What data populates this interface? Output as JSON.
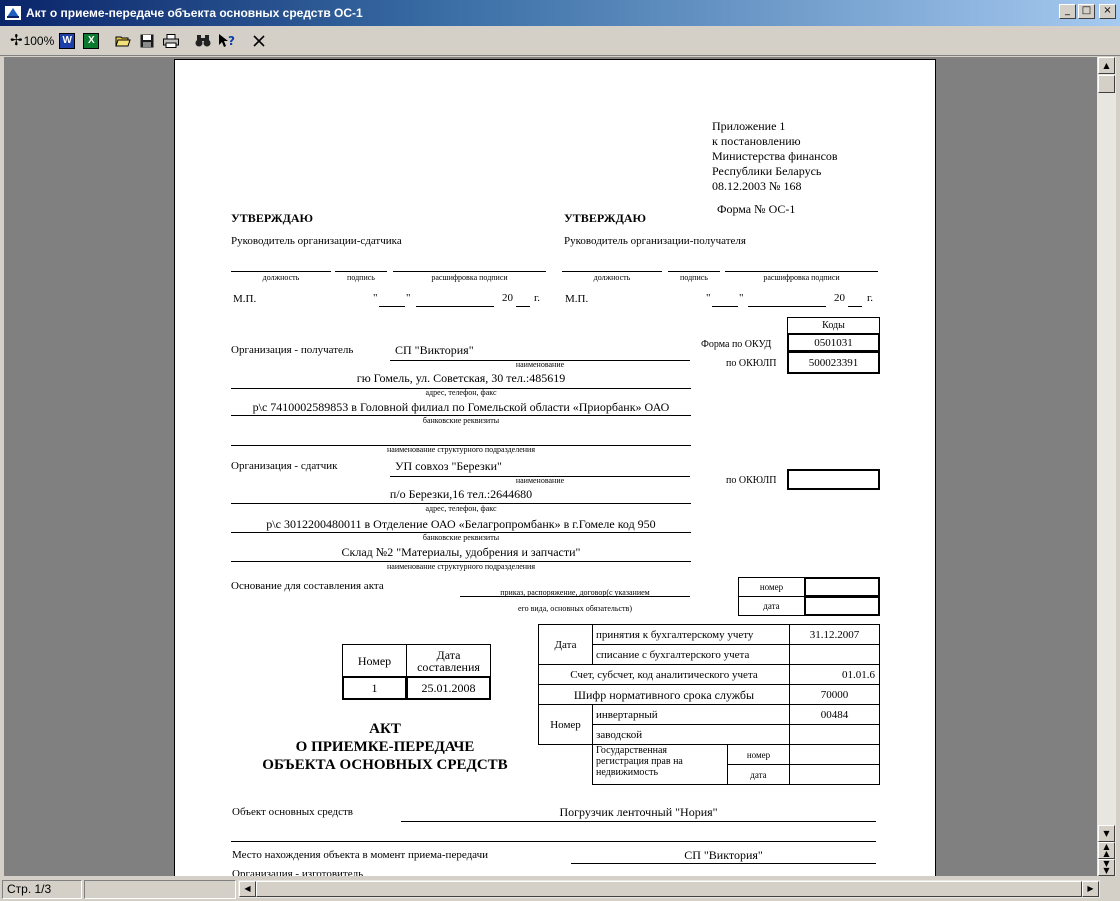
{
  "window": {
    "title": "Акт о приеме-передаче объекта основных средств ОС-1",
    "minimize": "_",
    "maximize": "□",
    "close": "×"
  },
  "toolbar": {
    "zoom_label": "100%",
    "word_label": "W",
    "excel_label": "X"
  },
  "status": {
    "page": "Стр. 1/3"
  },
  "doc": {
    "appendix": [
      "Приложение 1",
      "к постановлению",
      "Министерства финансов",
      "Республики Беларусь",
      "08.12.2003 № 168"
    ],
    "form_no": "Форма № ОС-1",
    "approve": "УТВЕРЖДАЮ",
    "sender_head": "Руководитель организации-сдатчика",
    "receiver_head": "Руководитель организации-получателя",
    "cap_position": "должность",
    "cap_signature": "подпись",
    "cap_decoding": "расшифровка подписи",
    "mp": "М.П.",
    "quote_open": "\"",
    "quote_close": "\"",
    "year_prefix": "20",
    "year_suffix": "г.",
    "codes_header": "Коды",
    "okud_label": "Форма по ОКУД",
    "okud_value": "0501031",
    "okulp_label": "по ОКЮЛП",
    "okulp_value": "500023391",
    "okulp_label2": "по ОКЮЛП",
    "okulp_value2": "",
    "receiver_label": "Организация - получатель",
    "receiver_name": "СП \"Виктория\"",
    "cap_name": "наименование",
    "receiver_address": "гю Гомель, ул. Советская, 30  тел.:485619",
    "cap_address": "адрес, телефон, факс",
    "receiver_bank": "р\\с 7410002589853 в Головной филиал по Гомельской области «Приорбанк» ОАО",
    "cap_bank": "банковские реквизиты",
    "receiver_unit": "",
    "cap_unit": "наименование структурного подразделения",
    "sender_label": "Организация - сдатчик",
    "sender_name": "УП совхоз \"Березки\"",
    "sender_address": "п/о Березки,16  тел.:2644680",
    "sender_bank": "р\\с 3012200480011 в Отделение ОАО «Белагропромбанк» в г.Гомеле код 950",
    "sender_unit": "Склад №2 \"Материалы, удобрения и запчасти\"",
    "basis_label": "Основание для составления акта",
    "basis_caption1": "приказ, распоряжение, договор(с указанием",
    "basis_caption2": "его вида, основных обязательств)",
    "num_label": "номер",
    "date_label": "дата",
    "doc_number_header": "Номер",
    "doc_date_header1": "Дата",
    "doc_date_header2": "составления",
    "doc_number": "1",
    "doc_date": "25.01.2008",
    "act_title": [
      "АКТ",
      "О ПРИЕМКЕ-ПЕРЕДАЧЕ",
      "ОБЪЕКТА ОСНОВНЫХ СРЕДСТВ"
    ],
    "date_group": "Дата",
    "accepted_label": "принятия к бухгалтерскому учету",
    "accepted_value": "31.12.2007",
    "writeoff_label": "списание с бухгалтерского учета",
    "writeoff_value": "",
    "account_label": "Счет, субсчет, код аналитического учета",
    "account_value": "01.01.6",
    "cipher_label": "Шифр нормативного срока службы",
    "cipher_value": "70000",
    "number_group": "Номер",
    "inventory_label": "инвертарный",
    "inventory_value": "00484",
    "factory_label": "заводской",
    "factory_value": "",
    "state_reg_label": [
      "Государственная",
      "регистрация прав на",
      "недвижимость"
    ],
    "object_label": "Объект основных средств",
    "object_value": "Погрузчик ленточный \"Нория\"",
    "location_label": "Место нахождения объекта в момент приема-передачи",
    "location_value": "СП \"Виктория\"",
    "manufacturer_label": "Организация - изготовитель"
  }
}
